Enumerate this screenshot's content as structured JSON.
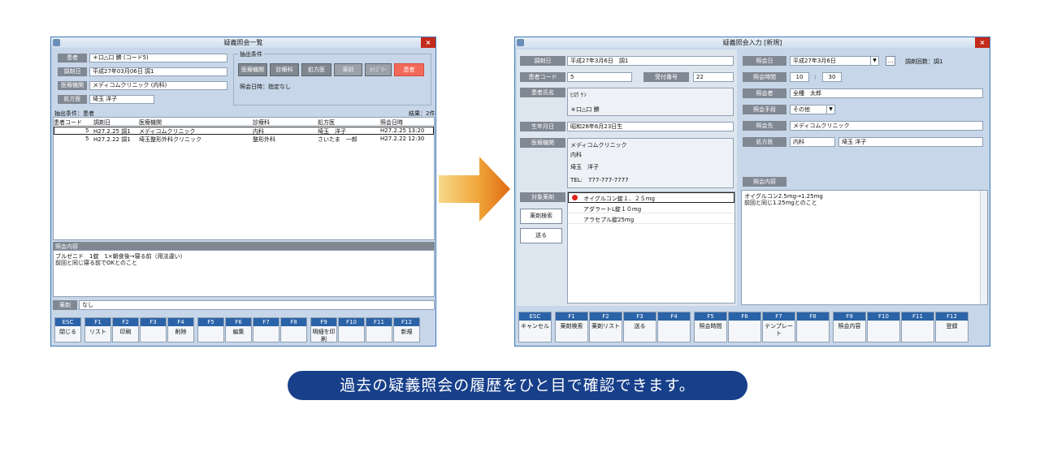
{
  "left_window": {
    "title": "疑義照会一覧",
    "patient_label": "患者",
    "patient_value": "＊口△口 勝 (コード5)",
    "date_label": "調剤日",
    "date_value": "平成27年03月06日 調1",
    "hospital_label": "医療機関",
    "hospital_value": "メディコムクリニック (内科)",
    "doctor_label": "処方医",
    "doctor_value": "埼玉 洋子",
    "filter_title": "抽出条件",
    "filter_buttons": [
      "医療機関",
      "診療科",
      "処方医",
      "薬剤",
      "ｶﾃｺﾞﾘｰ",
      "患者"
    ],
    "filter_datetime": "照会日時：指定なし",
    "condition_text": "抽出条件：患者",
    "result_count": "結果：2件",
    "columns": [
      "患者コード",
      "調剤日",
      "医療機関",
      "診療科",
      "処方医",
      "照会日時"
    ],
    "rows": [
      [
        "5",
        "H27.2.25 調1",
        "メディコムクリニック",
        "内科",
        "埼玉　洋子",
        "H27.2.25 13:20"
      ],
      [
        "5",
        "H27.2.22 調1",
        "埼玉整形外科クリニック",
        "整形外科",
        "さいたま　一郎",
        "H27.2.22 12:30"
      ]
    ],
    "content_header": "照会内容",
    "content_line1": "ブルゼニド　1錠　1×朝食後→寝る前（用法違い）",
    "content_line2": "前回と同じ寝る前でOKとのこと",
    "drug_label": "薬剤",
    "drug_value": "なし",
    "fkeys": [
      {
        "k": "ESC",
        "t": "閉じる"
      },
      {
        "k": "F1",
        "t": "リスト"
      },
      {
        "k": "F2",
        "t": "印刷"
      },
      {
        "k": "F3",
        "t": ""
      },
      {
        "k": "F4",
        "t": "削除"
      },
      {
        "k": "F5",
        "t": ""
      },
      {
        "k": "F6",
        "t": "編集"
      },
      {
        "k": "F7",
        "t": ""
      },
      {
        "k": "F8",
        "t": ""
      },
      {
        "k": "F9",
        "t": "明細を印刷"
      },
      {
        "k": "F10",
        "t": ""
      },
      {
        "k": "F11",
        "t": ""
      },
      {
        "k": "F12",
        "t": "新規"
      }
    ]
  },
  "right_window": {
    "title": "疑義照会入力 [新規]",
    "dispense_label": "調剤日",
    "dispense_value": "平成27年3月6日　調1",
    "pcode_label": "患者コード",
    "pcode_value": "5",
    "recv_label": "受付番号",
    "recv_value": "22",
    "pname_label": "患者氏名",
    "pname_kana": "ﾋﾛｳ ｹﾝ",
    "pname_value": "＊口△口 勝",
    "birth_label": "生年月日",
    "birth_value": "昭和28年6月23日生",
    "inst_label": "医療機関",
    "inst_lines": [
      "メディコムクリニック",
      "内科",
      "埼玉　洋子",
      "TEL:　777-777-7777"
    ],
    "target_label": "対象薬剤",
    "search_button": "薬剤検索",
    "send_button": "送る",
    "drugs": [
      "オイグルコン錠１．２５mg",
      "アダラートL錠１０mg",
      "アラセプル錠25mg"
    ],
    "date_label": "照会日",
    "date_value": "平成27年3月6日",
    "count_label": "調剤回数：調1",
    "time_label": "照会時間",
    "time_h": "10",
    "time_sep": ":",
    "time_m": "30",
    "person_label": "照会者",
    "person_value": "全種　太郎",
    "method_label": "照会手段",
    "method_value": "その他",
    "dest_label": "照会先",
    "dest_value": "メディコムクリニック",
    "presc_label": "処方医",
    "presc_dept": "内科",
    "presc_name": "埼玉 洋子",
    "content_label": "照会内容",
    "content_line1": "オイグルコン2.5mg→1.25mg",
    "content_line2": "前回と同じ1.25mgとのこと",
    "fkeys": [
      {
        "k": "ESC",
        "t": "キャンセル"
      },
      {
        "k": "F1",
        "t": "薬剤検索"
      },
      {
        "k": "F2",
        "t": "薬剤リスト"
      },
      {
        "k": "F3",
        "t": "送る"
      },
      {
        "k": "F4",
        "t": ""
      },
      {
        "k": "F5",
        "t": "照会時間"
      },
      {
        "k": "F6",
        "t": ""
      },
      {
        "k": "F7",
        "t": "テンプレート"
      },
      {
        "k": "F8",
        "t": ""
      },
      {
        "k": "F9",
        "t": "照会内容"
      },
      {
        "k": "F10",
        "t": ""
      },
      {
        "k": "F11",
        "t": ""
      },
      {
        "k": "F12",
        "t": "登録"
      }
    ]
  },
  "caption": "過去の疑義照会の履歴をひと目で確認できます。"
}
